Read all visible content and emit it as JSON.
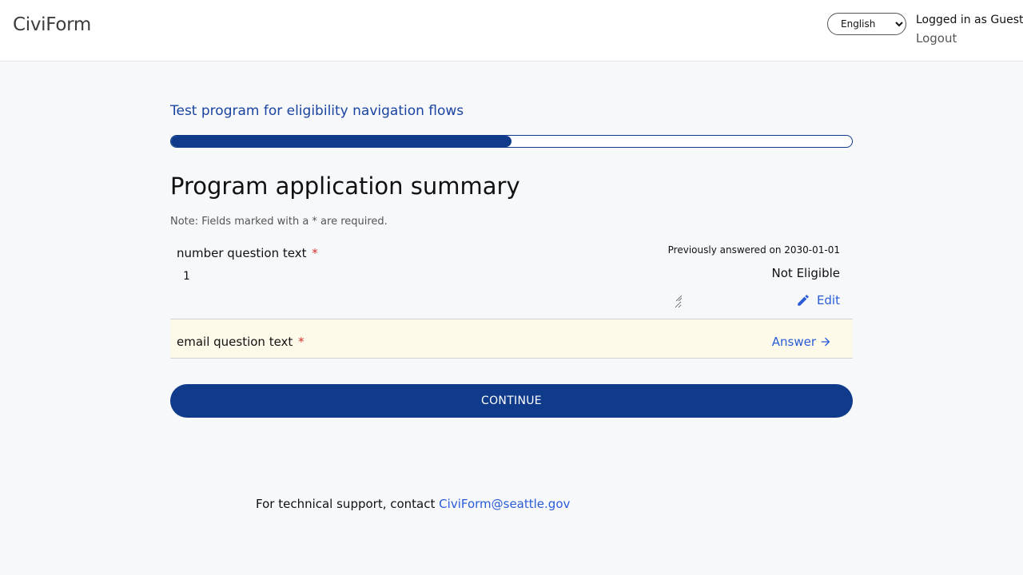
{
  "header": {
    "brand": "CiviForm",
    "language": {
      "selected": "English",
      "options": [
        "English"
      ]
    },
    "user_label": "Logged in as Guest",
    "logout_label": "Logout"
  },
  "program": {
    "name": "Test program for eligibility navigation flows",
    "progress_percent": 50
  },
  "summary": {
    "title": "Program application summary",
    "note": "Note: Fields marked with a * are required.",
    "required_marker": "*",
    "questions": [
      {
        "text": "number question text",
        "answer": "1",
        "previously_answered": "Previously answered on 2030-01-01",
        "eligibility": "Not Eligible",
        "action_label": "Edit",
        "action_icon": "pencil-icon"
      },
      {
        "text": "email question text",
        "action_label": "Answer",
        "action_icon": "arrow-right-icon"
      }
    ]
  },
  "continue_label": "CONTINUE",
  "footer": {
    "text": "For technical support, contact",
    "email": "CiviForm@seattle.gov"
  },
  "colors": {
    "primary": "#0f3b8a",
    "link": "#2a5bd7",
    "required": "#d63030",
    "highlight_row": "#fdfae9",
    "background": "#f7f8fa"
  }
}
